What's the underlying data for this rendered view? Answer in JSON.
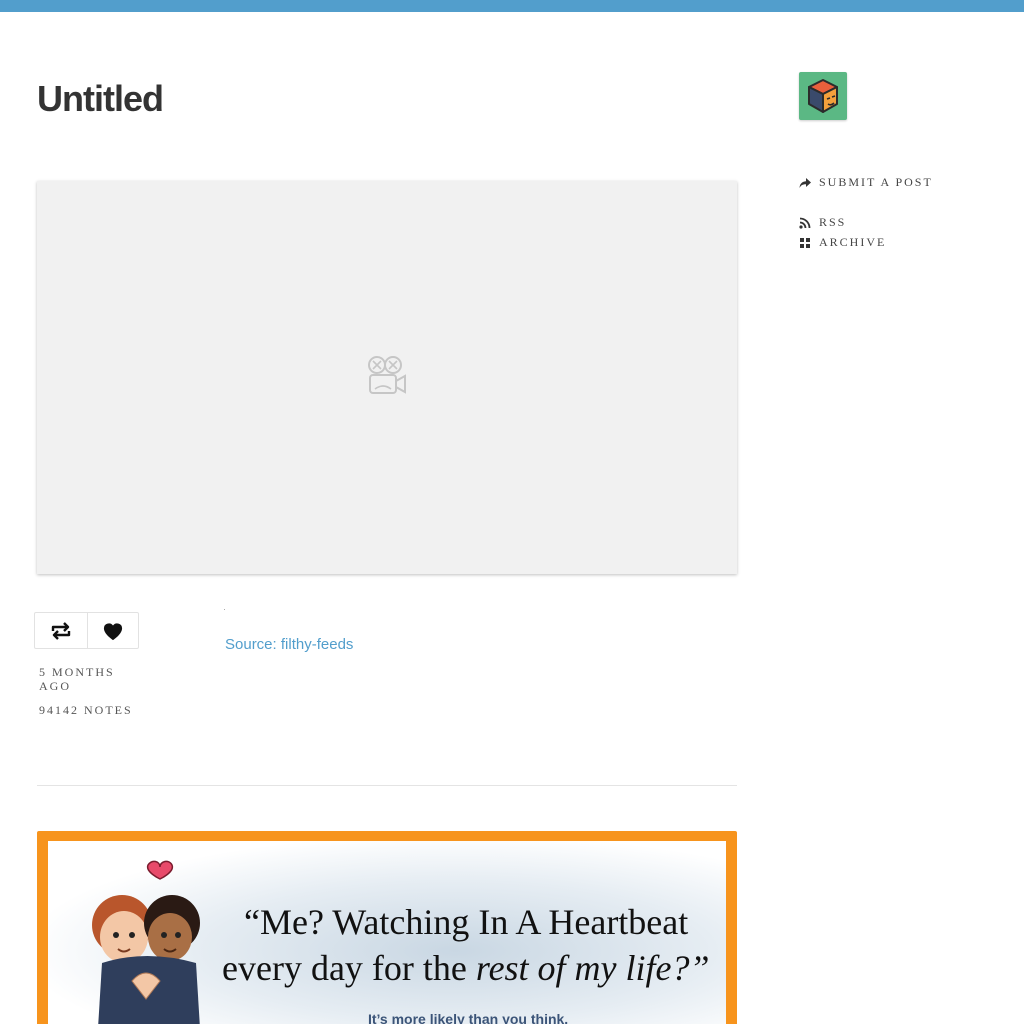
{
  "blog": {
    "title": "Untitled",
    "accent_color": "#529ecc"
  },
  "post": {
    "video_placeholder_icon": "broken-video-camera-icon",
    "reblog_icon": "reblog-icon",
    "like_icon": "heart-icon",
    "date": "5 MONTHS AGO",
    "notes": "94142 NOTES",
    "source_label": "Source:",
    "source_name": "filthy-feeds"
  },
  "ad": {
    "quote_line1": "“Me? Watching In A Heartbeat",
    "quote_line2_start": "every day for the ",
    "quote_line2_italic": "rest of my life?”",
    "tagline": "It’s more likely than you think.",
    "border_color": "#f7941d"
  },
  "sidebar": {
    "avatar_icon": "cube-avatar-icon",
    "links": [
      {
        "icon": "share-arrow-icon",
        "label": "SUBMIT A POST"
      },
      {
        "icon": "rss-icon",
        "label": "RSS"
      },
      {
        "icon": "grid-icon",
        "label": "ARCHIVE"
      }
    ]
  }
}
